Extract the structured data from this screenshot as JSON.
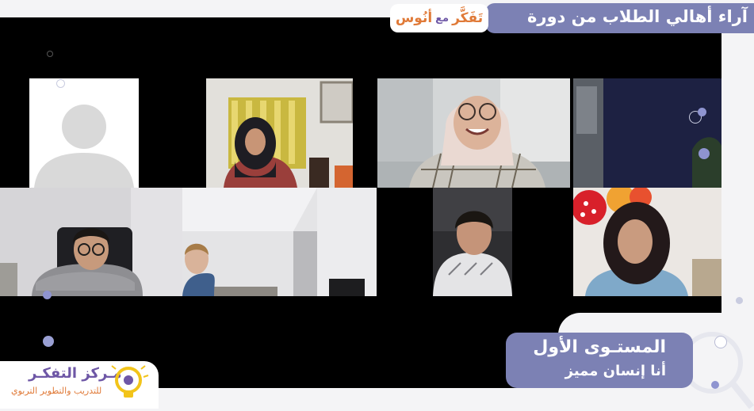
{
  "header": {
    "title": "آراء أهالي الطلاب من دورة",
    "logo_part1": "تَفَكَّر",
    "logo_part2": "مع",
    "logo_part3": "أنُوس"
  },
  "level_card": {
    "line1": "المستـوى الأول",
    "line2": "أنا إنسان مميز"
  },
  "center_logo": {
    "name": "مـركز التفكـر",
    "subtitle": "للتدريب والتطوير التربوي"
  },
  "participants": [
    {
      "name": "participant-1",
      "type": "avatar-placeholder"
    },
    {
      "name": "participant-2",
      "type": "video"
    },
    {
      "name": "participant-3",
      "type": "video"
    },
    {
      "name": "participant-4",
      "type": "video"
    },
    {
      "name": "participant-5",
      "type": "video"
    },
    {
      "name": "participant-6",
      "type": "video"
    },
    {
      "name": "participant-7",
      "type": "video"
    },
    {
      "name": "participant-8",
      "type": "video"
    }
  ],
  "colors": {
    "accent_purple": "#7c81b4",
    "brand_orange": "#e07a38",
    "brand_purple": "#6e57a6",
    "panel": "#000000"
  }
}
